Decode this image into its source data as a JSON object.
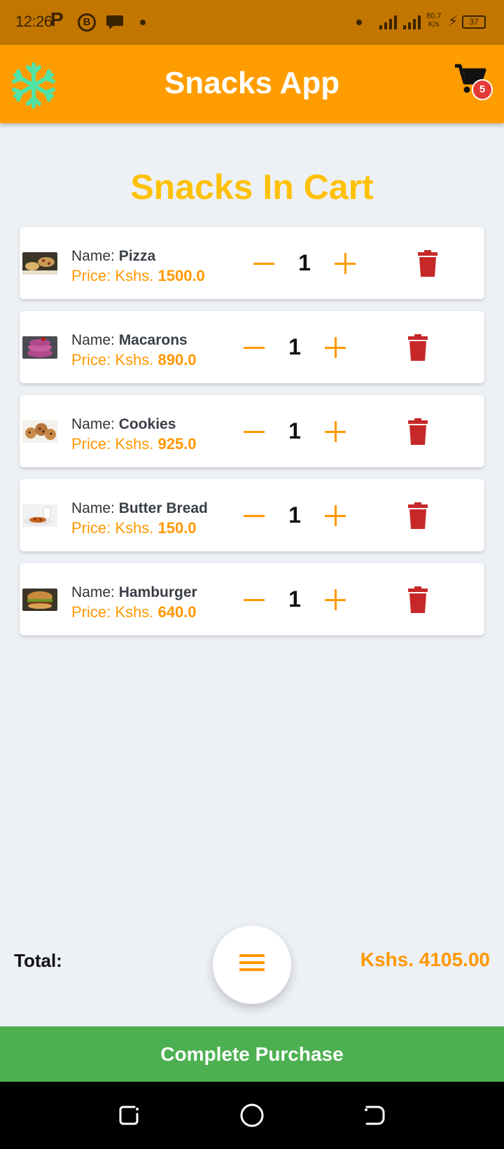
{
  "status_bar": {
    "time": "12:26",
    "net_speed_top": "80.7",
    "net_speed_bottom": "K/s",
    "battery": "37",
    "icons": [
      "p-app-icon",
      "b-app-icon",
      "chat-icon",
      "signal-icon",
      "charging-icon",
      "battery-icon"
    ]
  },
  "app_bar": {
    "title": "Snacks App",
    "logo_icon": "snowflake-icon",
    "cart_icon": "shopping-cart-icon",
    "cart_count": "5",
    "brand_color": "#ff9d00",
    "logo_color": "#4fe3a8"
  },
  "page": {
    "heading": "Snacks In Cart"
  },
  "cart": {
    "name_label": "Name: ",
    "price_label": "Price: Kshs. ",
    "items": [
      {
        "name": "Pizza",
        "price": "1500.0",
        "quantity": "1"
      },
      {
        "name": "Macarons",
        "price": "890.0",
        "quantity": "1"
      },
      {
        "name": "Cookies",
        "price": "925.0",
        "quantity": "1"
      },
      {
        "name": "Butter Bread",
        "price": "150.0",
        "quantity": "1"
      },
      {
        "name": "Hamburger",
        "price": "640.0",
        "quantity": "1"
      }
    ]
  },
  "summary": {
    "total_label": "Total:",
    "total_value": "Kshs. 4105.00",
    "menu_icon": "hamburger-menu-icon"
  },
  "actions": {
    "purchase_label": "Complete Purchase"
  },
  "colors": {
    "accent": "#ff9800",
    "heading": "#ffc107",
    "delete": "#c62828",
    "purchase": "#4caf50"
  }
}
